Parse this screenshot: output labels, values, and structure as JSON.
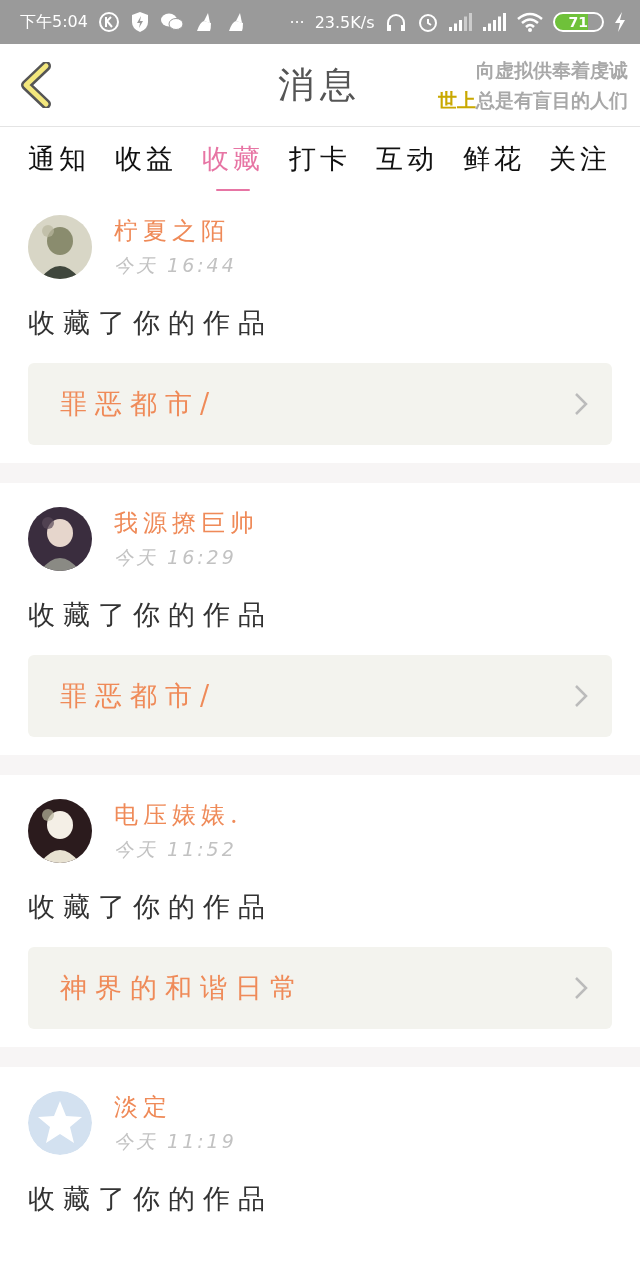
{
  "status_bar": {
    "time": "下午5:04",
    "dots": "···",
    "speed": "23.5K/s",
    "battery": "71"
  },
  "header": {
    "title": "消息",
    "lyrics": [
      {
        "rest": "向虚拟供奉着虔诚"
      },
      {
        "sung": "世上",
        "rest": "总是有盲目的人们"
      }
    ]
  },
  "tabs": [
    {
      "label": "通知",
      "selected": false
    },
    {
      "label": "收益",
      "selected": false
    },
    {
      "label": "收藏",
      "selected": true
    },
    {
      "label": "打卡",
      "selected": false
    },
    {
      "label": "互动",
      "selected": false
    },
    {
      "label": "鲜花",
      "selected": false
    },
    {
      "label": "关注",
      "selected": false
    }
  ],
  "messages": [
    {
      "name": "柠夏之陌",
      "time": "今天 16:44",
      "text": "收藏了你的作品",
      "work": "罪恶都市/"
    },
    {
      "name": "我源撩巨帅",
      "time": "今天 16:29",
      "text": "收藏了你的作品",
      "work": "罪恶都市/"
    },
    {
      "name": "电压婊婊.",
      "time": "今天 11:52",
      "text": "收藏了你的作品",
      "work": "神界的和谐日常"
    },
    {
      "avatar": {
        "kind": "default"
      },
      "name": "淡定",
      "time": "今天 11:19",
      "text": "收藏了你的作品"
    }
  ]
}
